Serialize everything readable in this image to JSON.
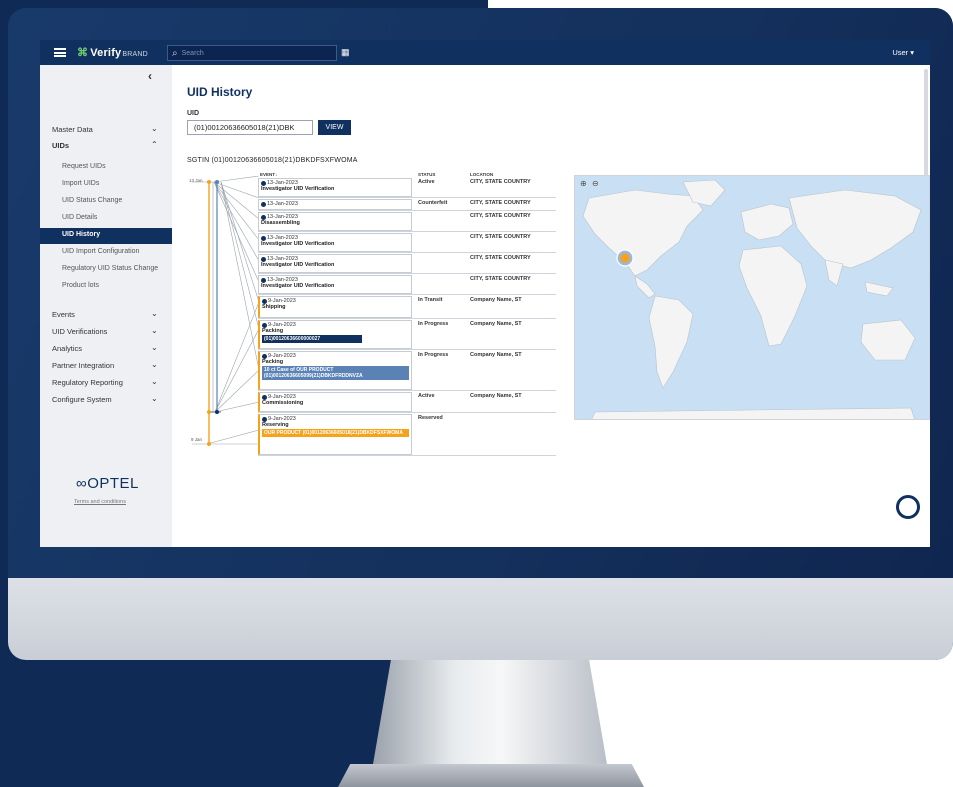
{
  "header": {
    "brand_mark": "⌘",
    "brand_name": "Verify",
    "brand_sub": "BRAND",
    "search_placeholder": "Search",
    "user_menu": "User ▾"
  },
  "sidebar": {
    "groups": [
      {
        "label": "Master Data",
        "chevron": "⌄"
      },
      {
        "label": "UIDs",
        "chevron": "⌃"
      }
    ],
    "uid_items": [
      "Request UIDs",
      "Import UIDs",
      "UID Status Change",
      "UID Details",
      "UID History",
      "UID Import Configuration",
      "Regulatory UID Status Change",
      "Product lots"
    ],
    "lower_groups": [
      "Events",
      "UID Verifications",
      "Analytics",
      "Partner Integration",
      "Regulatory Reporting",
      "Configure System"
    ],
    "footer_logo": "OPTEL",
    "terms": "Terms and conditions"
  },
  "main": {
    "title": "UID History",
    "uid_label": "UID",
    "uid_value": "(01)00120636605018(21)DBK",
    "view_button": "VIEW",
    "sgtin": "SGTIN (01)00120636605018(21)DBKDFSXFWOMA",
    "timeline_dates": [
      "13 Jan",
      "9 Jan"
    ],
    "columns": {
      "event": "EVENT↓",
      "status": "STATUS",
      "location": "LOCATION"
    },
    "events": [
      {
        "date": "13-Jan-2023",
        "type": "Investigator UID Verification",
        "status": "Active",
        "location": "CITY, STATE COUNTRY"
      },
      {
        "date": "13-Jan-2023",
        "type": "",
        "status": "Counterfeit",
        "location": "CITY, STATE COUNTRY"
      },
      {
        "date": "13-Jan-2023",
        "type": "Disassembling",
        "status": "",
        "location": "CITY, STATE COUNTRY"
      },
      {
        "date": "13-Jan-2023",
        "type": "Investigator UID Verification",
        "status": "",
        "location": "CITY, STATE COUNTRY"
      },
      {
        "date": "13-Jan-2023",
        "type": "Investigator UID Verification",
        "status": "",
        "location": "CITY, STATE COUNTRY"
      },
      {
        "date": "13-Jan-2023",
        "type": "Investigator UID Verification",
        "status": "",
        "location": "CITY, STATE COUNTRY"
      },
      {
        "date": "9-Jan-2023",
        "type": "Shipping",
        "status": "In Transit",
        "location": "Company Name, ST"
      },
      {
        "date": "9-Jan-2023",
        "type": "Packing",
        "status": "In Progress",
        "location": "Company Name, ST",
        "badge": "(01)00120636600000027"
      },
      {
        "date": "9-Jan-2023",
        "type": "Packing",
        "status": "In Progress",
        "location": "Company Name, ST",
        "badge": "10 ct Case of OUR PRODUCT (01)00120636605099(21)DBKDFRDDNVZA"
      },
      {
        "date": "9-Jan-2023",
        "type": "Commissioning",
        "status": "Active",
        "location": "Company Name, ST"
      },
      {
        "date": "9-Jan-2023",
        "type": "Reserving",
        "status": "Reserved",
        "location": "",
        "badge": "OUR PRODUCT (01)00120636605018(21)DBKDFSXFWOMA"
      }
    ],
    "map": {
      "zoom_in": "⊕",
      "zoom_out": "⊖"
    }
  },
  "colors": {
    "navy": "#10305f",
    "orange": "#f7a21b",
    "accent_blue": "#5b82b5",
    "map_sea": "#c9dff3",
    "map_land": "#f4f4f4"
  }
}
